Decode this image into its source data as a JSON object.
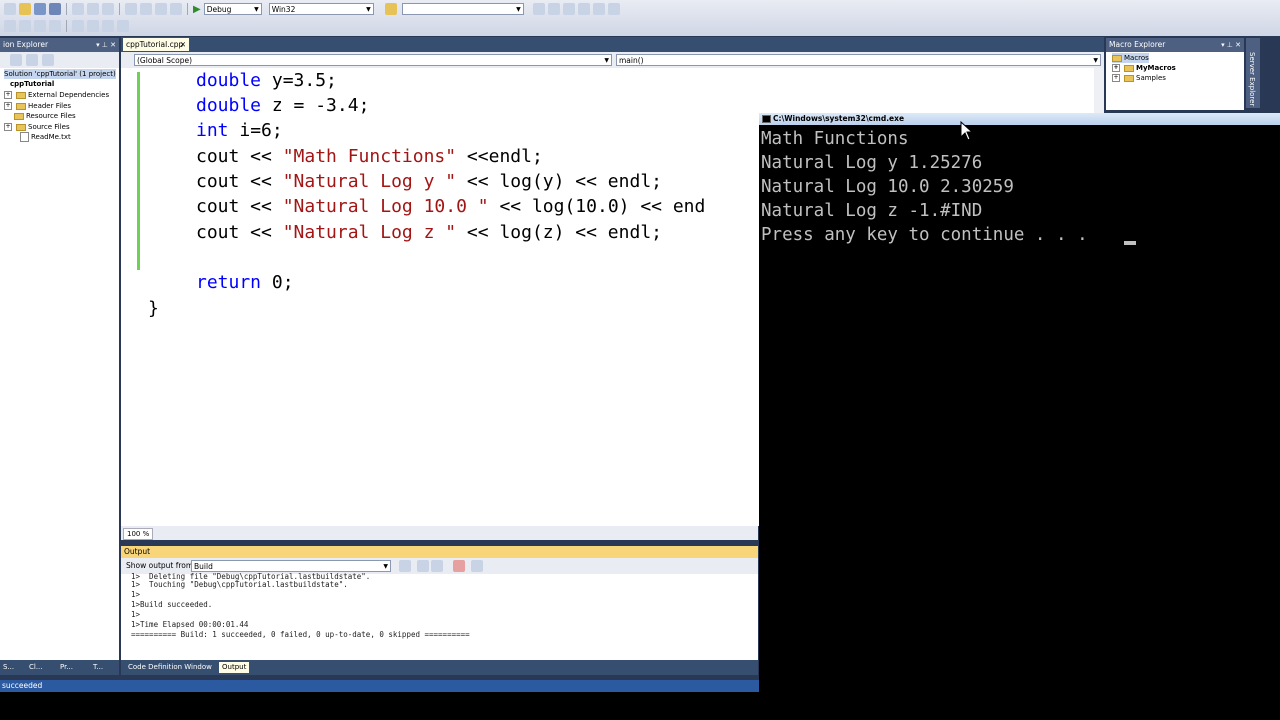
{
  "toolbar": {
    "config": "Debug",
    "platform": "Win32",
    "find_value": ""
  },
  "solution_explorer": {
    "title": "ion Explorer",
    "items": [
      {
        "label": "Solution 'cppTutorial' (1 project)"
      },
      {
        "label": "cppTutorial"
      },
      {
        "label": "External Dependencies"
      },
      {
        "label": "Header Files"
      },
      {
        "label": "Resource Files"
      },
      {
        "label": "Source Files"
      },
      {
        "label": "ReadMe.txt"
      }
    ]
  },
  "editor": {
    "tab": "cppTutorial.cpp",
    "scope": "(Global Scope)",
    "member": "main()",
    "zoom": "100 %",
    "code": [
      {
        "kw": "double",
        "rest": " y=3.5;"
      },
      {
        "kw": "double",
        "rest": " z = -3.4;"
      },
      {
        "kw": "int",
        "rest": " i=6;"
      },
      {
        "pre": "cout << ",
        "str": "\"Math Functions\"",
        "post": " <<endl;"
      },
      {
        "pre": "cout << ",
        "str": "\"Natural Log y \"",
        "post": " << log(y) << endl;"
      },
      {
        "pre": "cout << ",
        "str": "\"Natural Log 10.0 \"",
        "post": " << log(10.0) << end"
      },
      {
        "pre": "cout << ",
        "str": "\"Natural Log z \"",
        "post": " << log(z) << endl;"
      },
      {
        "kw": "return",
        "rest": " 0;"
      },
      {
        "plain": "}"
      }
    ]
  },
  "output": {
    "title": "Output",
    "show_from_label": "Show output from:",
    "show_from_value": "Build",
    "lines": [
      "1>  Deleting file \"Debug\\cppTutorial.lastbuildstate\".",
      "1>  Touching \"Debug\\cppTutorial.lastbuildstate\".",
      "1>",
      "1>Build succeeded.",
      "1>",
      "1>Time Elapsed 00:00:01.44",
      "========== Build: 1 succeeded, 0 failed, 0 up-to-date, 0 skipped =========="
    ]
  },
  "bottom_tabs": {
    "code_def": "Code Definition Window",
    "output": "Output",
    "left": [
      "S...",
      "Cl...",
      "Pr...",
      "T..."
    ]
  },
  "status": "succeeded",
  "macro_explorer": {
    "title": "Macro Explorer",
    "items": [
      "Macros",
      "MyMacros",
      "Samples"
    ],
    "side_tab": "Server Explorer"
  },
  "cmd": {
    "title": "C:\\Windows\\system32\\cmd.exe",
    "lines": [
      "Math Functions",
      "Natural Log y 1.25276",
      "Natural Log 10.0 2.30259",
      "Natural Log z -1.#IND",
      "Press any key to continue . . ."
    ]
  },
  "colors": {
    "chrome": "#293955",
    "keyword": "#0000ff",
    "string": "#a31515"
  }
}
